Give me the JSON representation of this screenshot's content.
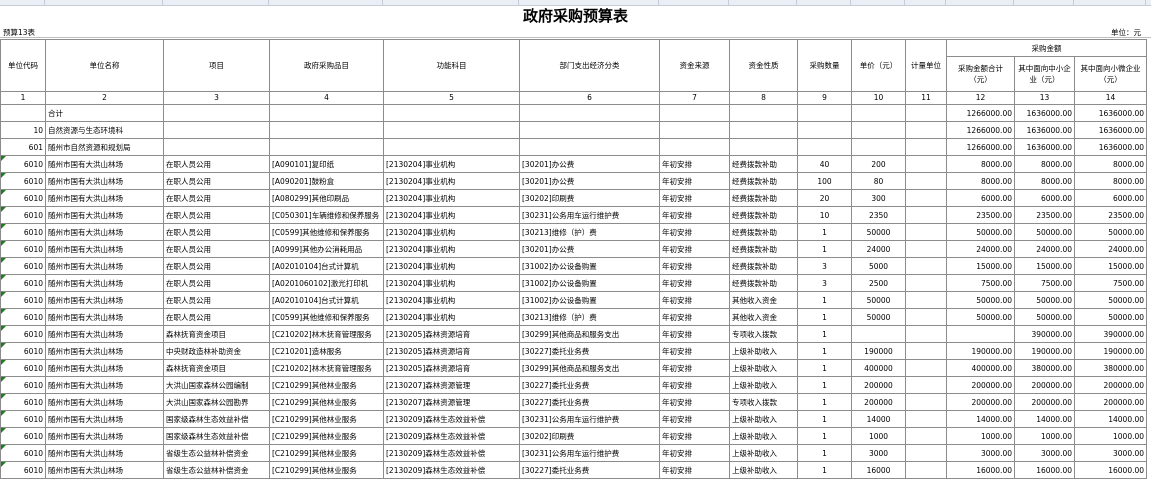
{
  "title": "政府采购预算表",
  "form_code": "预算13表",
  "unit": "单位：元",
  "headers": {
    "unit_code": "单位代码",
    "unit_name": "单位名称",
    "project": "项目",
    "gov_item": "政府采购品目",
    "func_subject": "功能科目",
    "dept_econ": "部门支出经济分类",
    "fund_source": "资金来源",
    "fund_nature": "资金性质",
    "qty": "采购数量",
    "price": "单价（元）",
    "measure": "计量单位",
    "amount_group": "采购金额",
    "amount_total": "采购金额合计（元）",
    "to_sme": "其中面向中小企业（元）",
    "to_micro": "其中面向小微企业（元）"
  },
  "col_index": [
    "1",
    "2",
    "3",
    "4",
    "5",
    "6",
    "7",
    "8",
    "9",
    "10",
    "11",
    "12",
    "13",
    "14"
  ],
  "rows": [
    {
      "code": "",
      "name": "合计",
      "project": "",
      "item": "",
      "func": "",
      "econ": "",
      "source": "",
      "nature": "",
      "qty": "",
      "price": "",
      "measure": "",
      "total": "1266000.00",
      "sme": "1636000.00",
      "micro": "1636000.00"
    },
    {
      "code": "10",
      "name": "自然资源与生态环境科",
      "project": "",
      "item": "",
      "func": "",
      "econ": "",
      "source": "",
      "nature": "",
      "qty": "",
      "price": "",
      "measure": "",
      "total": "1266000.00",
      "sme": "1636000.00",
      "micro": "1636000.00"
    },
    {
      "code": "601",
      "name": "随州市自然资源和规划局",
      "project": "",
      "item": "",
      "func": "",
      "econ": "",
      "source": "",
      "nature": "",
      "qty": "",
      "price": "",
      "measure": "",
      "total": "1266000.00",
      "sme": "1636000.00",
      "micro": "1636000.00"
    },
    {
      "code": "6010",
      "name": "随州市国有大洪山林场",
      "project": "在职人员公用",
      "item": "[A090101]复印纸",
      "func": "[2130204]事业机构",
      "econ": "[30201]办公费",
      "source": "年初安排",
      "nature": "经费拨款补助",
      "qty": "40",
      "price": "200",
      "measure": "",
      "total": "8000.00",
      "sme": "8000.00",
      "micro": "8000.00"
    },
    {
      "code": "6010",
      "name": "随州市国有大洪山林场",
      "project": "在职人员公用",
      "item": "[A090201]鼓粉盒",
      "func": "[2130204]事业机构",
      "econ": "[30201]办公费",
      "source": "年初安排",
      "nature": "经费拨款补助",
      "qty": "100",
      "price": "80",
      "measure": "",
      "total": "8000.00",
      "sme": "8000.00",
      "micro": "8000.00"
    },
    {
      "code": "6010",
      "name": "随州市国有大洪山林场",
      "project": "在职人员公用",
      "item": "[A080299]其他印刷品",
      "func": "[2130204]事业机构",
      "econ": "[30202]印刷费",
      "source": "年初安排",
      "nature": "经费拨款补助",
      "qty": "20",
      "price": "300",
      "measure": "",
      "total": "6000.00",
      "sme": "6000.00",
      "micro": "6000.00"
    },
    {
      "code": "6010",
      "name": "随州市国有大洪山林场",
      "project": "在职人员公用",
      "item": "[C050301]车辆维修和保养服务",
      "func": "[2130204]事业机构",
      "econ": "[30231]公务用车运行维护费",
      "source": "年初安排",
      "nature": "经费拨款补助",
      "qty": "10",
      "price": "2350",
      "measure": "",
      "total": "23500.00",
      "sme": "23500.00",
      "micro": "23500.00"
    },
    {
      "code": "6010",
      "name": "随州市国有大洪山林场",
      "project": "在职人员公用",
      "item": "[C0599]其他维修和保养服务",
      "func": "[2130204]事业机构",
      "econ": "[30213]维修（护）费",
      "source": "年初安排",
      "nature": "经费拨款补助",
      "qty": "1",
      "price": "50000",
      "measure": "",
      "total": "50000.00",
      "sme": "50000.00",
      "micro": "50000.00"
    },
    {
      "code": "6010",
      "name": "随州市国有大洪山林场",
      "project": "在职人员公用",
      "item": "[A0999]其他办公消耗用品",
      "func": "[2130204]事业机构",
      "econ": "[30201]办公费",
      "source": "年初安排",
      "nature": "经费拨款补助",
      "qty": "1",
      "price": "24000",
      "measure": "",
      "total": "24000.00",
      "sme": "24000.00",
      "micro": "24000.00"
    },
    {
      "code": "6010",
      "name": "随州市国有大洪山林场",
      "project": "在职人员公用",
      "item": "[A02010104]台式计算机",
      "func": "[2130204]事业机构",
      "econ": "[31002]办公设备购置",
      "source": "年初安排",
      "nature": "经费拨款补助",
      "qty": "3",
      "price": "5000",
      "measure": "",
      "total": "15000.00",
      "sme": "15000.00",
      "micro": "15000.00"
    },
    {
      "code": "6010",
      "name": "随州市国有大洪山林场",
      "project": "在职人员公用",
      "item": "[A0201060102]激光打印机",
      "func": "[2130204]事业机构",
      "econ": "[31002]办公设备购置",
      "source": "年初安排",
      "nature": "经费拨款补助",
      "qty": "3",
      "price": "2500",
      "measure": "",
      "total": "7500.00",
      "sme": "7500.00",
      "micro": "7500.00"
    },
    {
      "code": "6010",
      "name": "随州市国有大洪山林场",
      "project": "在职人员公用",
      "item": "[A02010104]台式计算机",
      "func": "[2130204]事业机构",
      "econ": "[31002]办公设备购置",
      "source": "年初安排",
      "nature": "其他收入资金",
      "qty": "1",
      "price": "50000",
      "measure": "",
      "total": "50000.00",
      "sme": "50000.00",
      "micro": "50000.00"
    },
    {
      "code": "6010",
      "name": "随州市国有大洪山林场",
      "project": "在职人员公用",
      "item": "[C0599]其他维修和保养服务",
      "func": "[2130204]事业机构",
      "econ": "[30213]维修（护）费",
      "source": "年初安排",
      "nature": "其他收入资金",
      "qty": "1",
      "price": "50000",
      "measure": "",
      "total": "50000.00",
      "sme": "50000.00",
      "micro": "50000.00"
    },
    {
      "code": "6010",
      "name": "随州市国有大洪山林场",
      "project": "森林抚育资金项目",
      "item": "[C210202]林木抚育管理服务",
      "func": "[2130205]森林资源培育",
      "econ": "[30299]其他商品和服务支出",
      "source": "年初安排",
      "nature": "专项收入拨款",
      "qty": "1",
      "price": "",
      "measure": "",
      "total": "",
      "sme": "390000.00",
      "micro": "390000.00"
    },
    {
      "code": "6010",
      "name": "随州市国有大洪山林场",
      "project": "中央财政造林补助资金",
      "item": "[C210201]造林服务",
      "func": "[2130205]森林资源培育",
      "econ": "[30227]委托业务费",
      "source": "年初安排",
      "nature": "上级补助收入",
      "qty": "1",
      "price": "190000",
      "measure": "",
      "total": "190000.00",
      "sme": "190000.00",
      "micro": "190000.00"
    },
    {
      "code": "6010",
      "name": "随州市国有大洪山林场",
      "project": "森林抚育资金项目",
      "item": "[C210202]林木抚育管理服务",
      "func": "[2130205]森林资源培育",
      "econ": "[30299]其他商品和服务支出",
      "source": "年初安排",
      "nature": "上级补助收入",
      "qty": "1",
      "price": "400000",
      "measure": "",
      "total": "400000.00",
      "sme": "380000.00",
      "micro": "380000.00"
    },
    {
      "code": "6010",
      "name": "随州市国有大洪山林场",
      "project": "大洪山国家森林公园编制",
      "item": "[C210299]其他林业服务",
      "func": "[2130207]森林资源管理",
      "econ": "[30227]委托业务费",
      "source": "年初安排",
      "nature": "上级补助收入",
      "qty": "1",
      "price": "200000",
      "measure": "",
      "total": "200000.00",
      "sme": "200000.00",
      "micro": "200000.00"
    },
    {
      "code": "6010",
      "name": "随州市国有大洪山林场",
      "project": "大洪山国家森林公园勘界",
      "item": "[C210299]其他林业服务",
      "func": "[2130207]森林资源管理",
      "econ": "[30227]委托业务费",
      "source": "年初安排",
      "nature": "专项收入拨款",
      "qty": "1",
      "price": "200000",
      "measure": "",
      "total": "200000.00",
      "sme": "200000.00",
      "micro": "200000.00"
    },
    {
      "code": "6010",
      "name": "随州市国有大洪山林场",
      "project": "国家级森林生态效益补偿",
      "item": "[C210299]其他林业服务",
      "func": "[2130209]森林生态效益补偿",
      "econ": "[30231]公务用车运行维护费",
      "source": "年初安排",
      "nature": "上级补助收入",
      "qty": "1",
      "price": "14000",
      "measure": "",
      "total": "14000.00",
      "sme": "14000.00",
      "micro": "14000.00"
    },
    {
      "code": "6010",
      "name": "随州市国有大洪山林场",
      "project": "国家级森林生态效益补偿",
      "item": "[C210299]其他林业服务",
      "func": "[2130209]森林生态效益补偿",
      "econ": "[30202]印刷费",
      "source": "年初安排",
      "nature": "上级补助收入",
      "qty": "1",
      "price": "1000",
      "measure": "",
      "total": "1000.00",
      "sme": "1000.00",
      "micro": "1000.00"
    },
    {
      "code": "6010",
      "name": "随州市国有大洪山林场",
      "project": "省级生态公益林补偿资金",
      "item": "[C210299]其他林业服务",
      "func": "[2130209]森林生态效益补偿",
      "econ": "[30231]公务用车运行维护费",
      "source": "年初安排",
      "nature": "上级补助收入",
      "qty": "1",
      "price": "3000",
      "measure": "",
      "total": "3000.00",
      "sme": "3000.00",
      "micro": "3000.00"
    },
    {
      "code": "6010",
      "name": "随州市国有大洪山林场",
      "project": "省级生态公益林补偿资金",
      "item": "[C210299]其他林业服务",
      "func": "[2130209]森林生态效益补偿",
      "econ": "[30227]委托业务费",
      "source": "年初安排",
      "nature": "上级补助收入",
      "qty": "1",
      "price": "16000",
      "measure": "",
      "total": "16000.00",
      "sme": "16000.00",
      "micro": "16000.00"
    }
  ]
}
